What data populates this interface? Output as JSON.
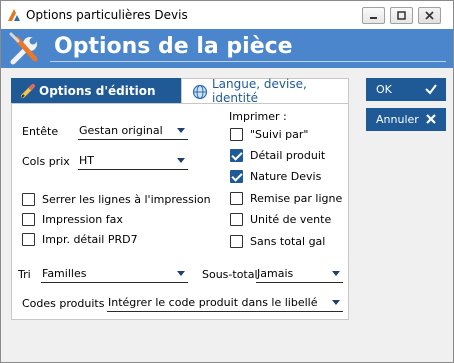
{
  "window": {
    "title": "Options particulières Devis",
    "header_title": "Options de la pièce"
  },
  "tabs": [
    {
      "label": "Options d'édition",
      "icon": "pencil-icon",
      "active": true
    },
    {
      "label": "Langue, devise, identité",
      "icon": "globe-icon",
      "active": false
    }
  ],
  "fields": {
    "entete": {
      "label": "Entête",
      "value": "Gestan original"
    },
    "cols_prix": {
      "label": "Cols prix",
      "value": "HT"
    },
    "tri": {
      "label": "Tri",
      "value": "Familles"
    },
    "sous_total": {
      "label": "Sous-total",
      "value": "Jamais"
    },
    "codes_produits": {
      "label": "Codes produits",
      "value": "Intégrer le code produit dans le libellé"
    }
  },
  "left_checks": [
    {
      "label": "Serrer les lignes à l'impression",
      "checked": false
    },
    {
      "label": "Impression fax",
      "checked": false
    },
    {
      "label": "Impr. détail PRD7",
      "checked": false
    }
  ],
  "imprimer": {
    "heading": "Imprimer :",
    "items": [
      {
        "label": "\"Suivi par\"",
        "checked": false
      },
      {
        "label": "Détail produit",
        "checked": true
      },
      {
        "label": "Nature Devis",
        "checked": true
      },
      {
        "label": "Remise par ligne",
        "checked": false
      },
      {
        "label": "Unité de vente",
        "checked": false
      },
      {
        "label": "Sans total gal",
        "checked": false
      }
    ]
  },
  "buttons": {
    "ok": "OK",
    "cancel": "Annuler"
  },
  "colors": {
    "accent": "#1f5a97",
    "header": "#4b86cc"
  }
}
